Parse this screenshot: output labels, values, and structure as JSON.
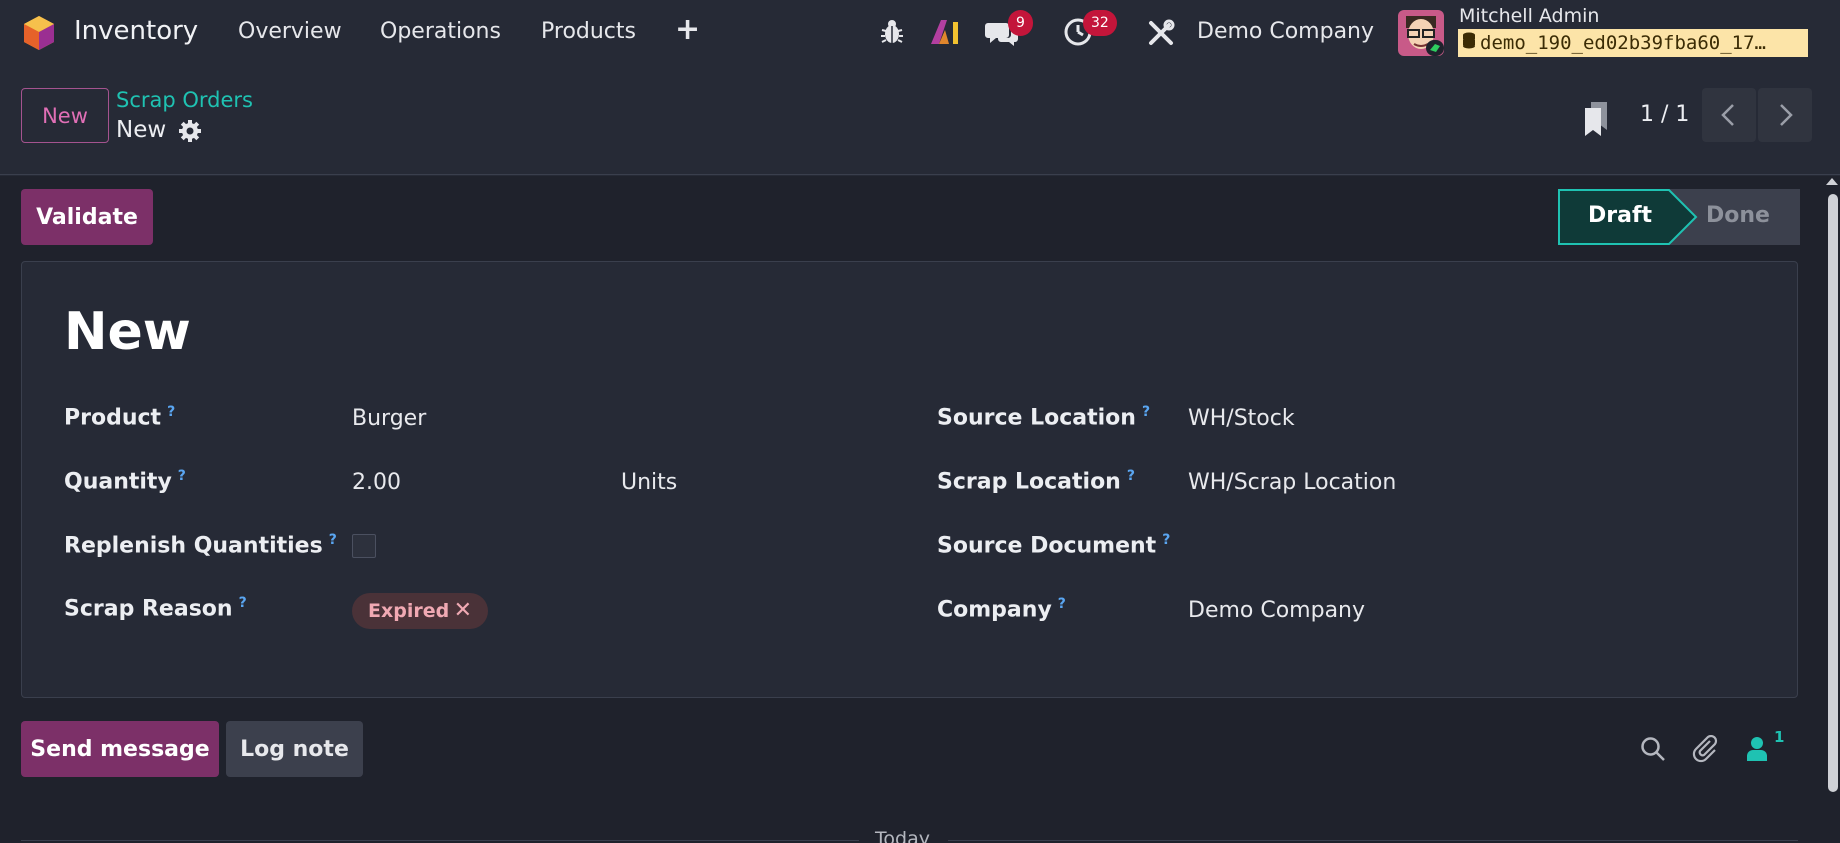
{
  "navbar": {
    "app_name": "Inventory",
    "menu": [
      "Overview",
      "Operations",
      "Products"
    ],
    "plus_icon": "+",
    "messages_badge": "9",
    "activities_badge": "32",
    "company": "Demo Company",
    "user_name": "Mitchell Admin",
    "database": "demo_190_ed02b39fba60_17…",
    "icons": [
      "bug-icon",
      "odoo-ai-icon",
      "chat-icon",
      "clock-icon",
      "tools-icon",
      "database-icon"
    ]
  },
  "control_panel": {
    "new_button": "New",
    "breadcrumb_parent": "Scrap Orders",
    "breadcrumb_current": "New",
    "pager_value": "1 / 1"
  },
  "form": {
    "validate_button": "Validate",
    "status": {
      "active": "Draft",
      "next": "Done"
    },
    "title": "New",
    "help_marker": "?",
    "left_fields": {
      "product_label": "Product",
      "product_value": "Burger",
      "quantity_label": "Quantity",
      "quantity_value": "2.00",
      "quantity_uom": "Units",
      "replenish_label": "Replenish Quantities",
      "replenish_checked": false,
      "reason_label": "Scrap Reason",
      "reason_tag": "Expired"
    },
    "right_fields": {
      "source_location_label": "Source Location",
      "source_location_value": "WH/Stock",
      "scrap_location_label": "Scrap Location",
      "scrap_location_value": "WH/Scrap Location",
      "source_document_label": "Source Document",
      "source_document_value": "",
      "company_label": "Company",
      "company_value": "Demo Company"
    }
  },
  "chatter": {
    "send_message": "Send message",
    "log_note": "Log note",
    "followers_count": "1",
    "today_label": "Today"
  },
  "colors": {
    "accent_primary": "#7c3068",
    "accent_teal": "#1fc2b2",
    "badge_red": "#c3153a",
    "background": "#1f222c"
  }
}
